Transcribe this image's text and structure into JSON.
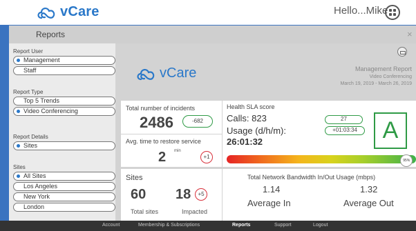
{
  "header": {
    "brand": "vCare",
    "greeting": "Hello...Mike"
  },
  "dialog": {
    "title": "Reports",
    "close_symbol": "×"
  },
  "sidebar": {
    "report_user": {
      "title": "Report User",
      "options": [
        "Management",
        "Staff"
      ],
      "selected": "Management"
    },
    "report_type": {
      "title": "Report Type",
      "options": [
        "Top 5 Trends",
        "Video Conferencing"
      ],
      "selected": "Video Conferencing"
    },
    "report_details": {
      "title": "Report Details",
      "options": [
        "Sites"
      ],
      "selected": "Sites"
    },
    "sites": {
      "title": "Sites",
      "options": [
        "All Sites",
        "Los Angeles",
        "New York",
        "London"
      ],
      "selected": "All Sites"
    }
  },
  "report": {
    "brand": "vCare",
    "title": "Management Report",
    "subtitle": "Video Conferencing",
    "date_range": "March 19, 2019 - March 26, 2019",
    "incidents": {
      "label": "Total number of incidents",
      "value": "2486",
      "delta": "-682"
    },
    "restore": {
      "label": "Avg. time to restore service",
      "value": "2",
      "unit": "min",
      "delta": "+1"
    },
    "sla": {
      "label": "Health SLA score",
      "calls_label": "Calls: 823",
      "calls_badge": "27",
      "usage_label": "Usage (d/h/m):",
      "usage_value": "26:01:32",
      "usage_badge": "+01:03:34",
      "grade": "A",
      "score_pct": "95%",
      "score_fraction": 0.95
    },
    "sites": {
      "label": "Sites",
      "total": "60",
      "total_label": "Total sites",
      "impacted": "18",
      "impacted_label": "Impacted",
      "impacted_delta": "+5"
    },
    "bandwidth": {
      "label": "Total Network Bandwidth In/Out Usage (mbps)",
      "in_value": "1.14",
      "in_label": "Average In",
      "out_value": "1.32",
      "out_label": "Average Out"
    }
  },
  "footer": {
    "links": [
      "Account",
      "Membership & Subscriptions",
      "Reports",
      "Support",
      "Logout"
    ],
    "active": "Reports"
  },
  "colors": {
    "brand_blue": "#2a78c9",
    "good_green": "#2e9a45",
    "alert_red": "#d8303a",
    "footer_bg": "#333333"
  }
}
